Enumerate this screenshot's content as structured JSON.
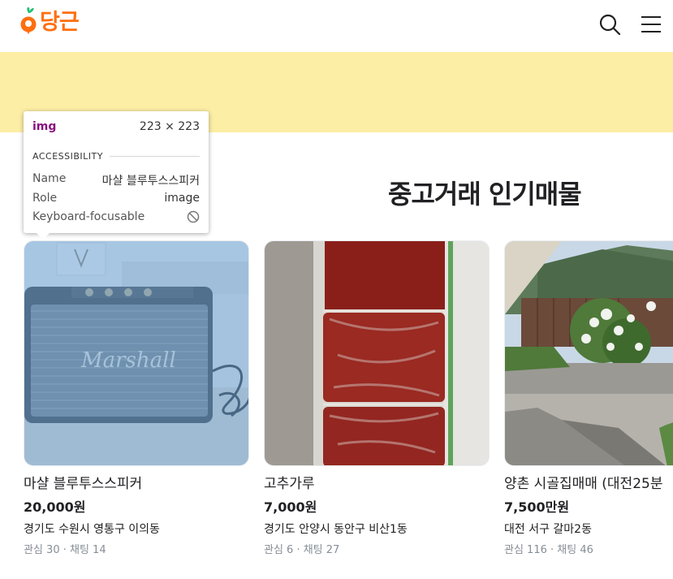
{
  "header": {
    "logo_text": "당근",
    "search_icon": "search-icon",
    "menu_icon": "hamburger-menu-icon",
    "brand_color": "#ff6f0f"
  },
  "banner": {
    "color": "#fdeea5"
  },
  "section": {
    "title": "중고거래 인기매물"
  },
  "cards": [
    {
      "title": "마샬 블루투스스피커",
      "price": "20,000원",
      "region": "경기도 수원시 영통구 이의동",
      "counts": "관심 30 · 채팅 14",
      "image": "marshall-speaker-photo"
    },
    {
      "title": "고추가루",
      "price": "7,000원",
      "region": "경기도 안양시 동안구 비산1동",
      "counts": "관심 6 · 채팅 27",
      "image": "red-pepper-powder-photo"
    },
    {
      "title": "양촌 시골집매매 (대전25분",
      "price": "7,500만원",
      "region": "대전 서구 갈마2동",
      "counts": "관심 116 · 채팅 46",
      "image": "countryside-house-photo"
    }
  ],
  "devtools_tooltip": {
    "tag": "img",
    "size": "223 × 223",
    "section": "ACCESSIBILITY",
    "rows": [
      {
        "label": "Name",
        "value": "마샬 블루투스스피커"
      },
      {
        "label": "Role",
        "value": "image"
      },
      {
        "label": "Keyboard-focusable",
        "value": ""
      }
    ],
    "highlight_color": "#6fa8dc"
  }
}
